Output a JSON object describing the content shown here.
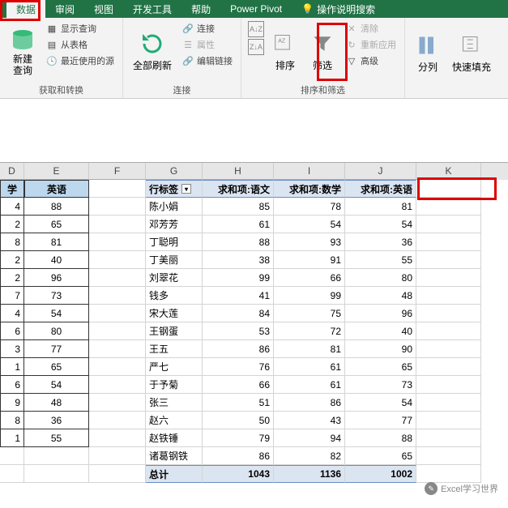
{
  "tabs": {
    "data": "数据",
    "review": "审阅",
    "view": "视图",
    "dev": "开发工具",
    "help": "帮助",
    "pivot": "Power Pivot",
    "tellme": "操作说明搜索"
  },
  "ribbon": {
    "get": {
      "label": "获取和转换",
      "new_query": "新建\n查询",
      "show_q": "显示查询",
      "from_table": "从表格",
      "recent": "最近使用的源"
    },
    "conn": {
      "label": "连接",
      "refresh": "全部刷新",
      "connections": "连接",
      "properties": "属性",
      "edit_links": "编辑链接"
    },
    "sort": {
      "label": "排序和筛选",
      "sort": "排序",
      "filter": "筛选",
      "clear": "清除",
      "reapply": "重新应用",
      "advanced": "高级"
    },
    "tools": {
      "text_cols": "分列",
      "flash": "快速填充"
    }
  },
  "cols": [
    "D",
    "E",
    "F",
    "G",
    "H",
    "I",
    "J",
    "K"
  ],
  "left_hdr": {
    "d": "学",
    "e": "英语"
  },
  "left_rows": [
    [
      "4",
      "88"
    ],
    [
      "2",
      "65"
    ],
    [
      "8",
      "81"
    ],
    [
      "2",
      "40"
    ],
    [
      "2",
      "96"
    ],
    [
      "7",
      "73"
    ],
    [
      "4",
      "54"
    ],
    [
      "6",
      "80"
    ],
    [
      "3",
      "77"
    ],
    [
      "1",
      "65"
    ],
    [
      "6",
      "54"
    ],
    [
      "9",
      "48"
    ],
    [
      "8",
      "36"
    ],
    [
      "1",
      "55"
    ]
  ],
  "pivot_hdr": {
    "rowlabel": "行标签",
    "c1": "求和项:语文",
    "c2": "求和项:数学",
    "c3": "求和项:英语"
  },
  "pivot_rows": [
    {
      "n": "陈小娟",
      "v": [
        85,
        78,
        81
      ]
    },
    {
      "n": "邓芳芳",
      "v": [
        61,
        54,
        54
      ]
    },
    {
      "n": "丁聪明",
      "v": [
        88,
        93,
        36
      ]
    },
    {
      "n": "丁美丽",
      "v": [
        38,
        91,
        55
      ]
    },
    {
      "n": "刘翠花",
      "v": [
        99,
        66,
        80
      ]
    },
    {
      "n": "钱多",
      "v": [
        41,
        99,
        48
      ]
    },
    {
      "n": "宋大莲",
      "v": [
        84,
        75,
        96
      ]
    },
    {
      "n": "王钢蛋",
      "v": [
        53,
        72,
        40
      ]
    },
    {
      "n": "王五",
      "v": [
        86,
        81,
        90
      ]
    },
    {
      "n": "严七",
      "v": [
        76,
        61,
        65
      ]
    },
    {
      "n": "于予菊",
      "v": [
        66,
        61,
        73
      ]
    },
    {
      "n": "张三",
      "v": [
        51,
        86,
        54
      ]
    },
    {
      "n": "赵六",
      "v": [
        50,
        43,
        77
      ]
    },
    {
      "n": "赵铁锤",
      "v": [
        79,
        94,
        88
      ]
    },
    {
      "n": "诸葛钢铁",
      "v": [
        86,
        82,
        65
      ]
    }
  ],
  "pivot_total": {
    "label": "总计",
    "v": [
      1043,
      1136,
      1002
    ]
  },
  "watermark": "Excel学习世界"
}
